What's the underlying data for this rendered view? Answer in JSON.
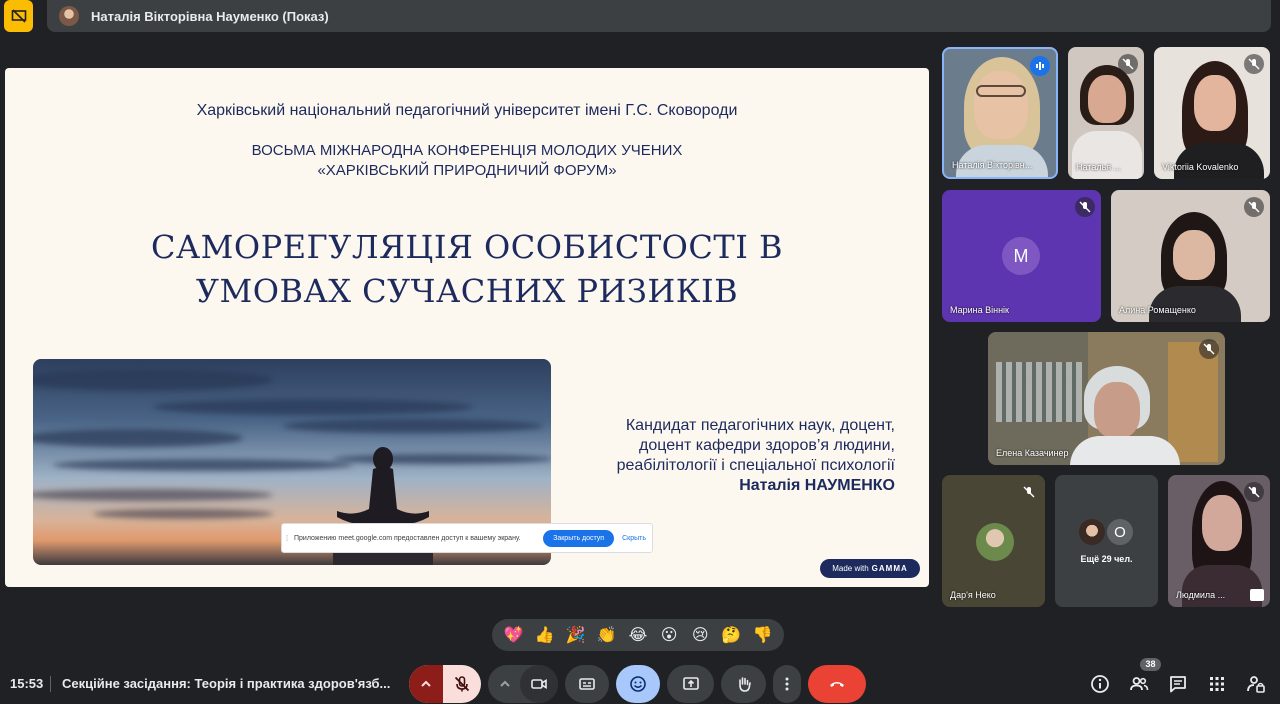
{
  "presenter_banner": {
    "text": "Наталія Вікторівна Науменко (Показ)"
  },
  "slide": {
    "university": "Харківський національний педагогічний університет імені Г.С. Сковороди",
    "conference_line1": "ВОСЬМА МІЖНАРОДНА КОНФЕРЕНЦІЯ МОЛОДИХ УЧЕНИХ",
    "conference_line2": "«ХАРКІВСЬКИЙ ПРИРОДНИЧИЙ ФОРУМ»",
    "title_line1": "САМОРЕГУЛЯЦІЯ ОСОБИСТОСТІ В",
    "title_line2": "УМОВАХ СУЧАСНИХ РИЗИКІВ",
    "author_line1": "Кандидат педагогічних наук, доцент,",
    "author_line2": "доцент кафедри здоров’я людини,",
    "author_line3": "реабілітології і спеціальної психології",
    "author_name": "Наталія НАУМЕНКО",
    "made_with": "Made with",
    "made_with_brand": "GAMMA"
  },
  "share_notification": {
    "text": "Приложению meet.google.com предоставлен доступ к вашему экрану.",
    "stop_label": "Закрыть доступ",
    "hide_label": "Скрыть"
  },
  "participants": [
    {
      "name": "Наталія Вікторівн...",
      "status": "speaking"
    },
    {
      "name": "Наталья ...",
      "status": "muted"
    },
    {
      "name": "Viktoriia Kovalenko",
      "status": "muted"
    },
    {
      "name": "Марина Віннік",
      "status": "muted",
      "initial": "M"
    },
    {
      "name": "Алина Ромащенко",
      "status": "muted"
    },
    {
      "name": "Елена Казачинер",
      "status": "muted"
    },
    {
      "name": "Дар'я Неко",
      "status": "muted"
    },
    {
      "name": "Ещё 29 чел.",
      "initial": "O"
    },
    {
      "name": "Людмила ...",
      "status": "muted"
    }
  ],
  "reactions": [
    "💖",
    "👍",
    "🎉",
    "👏",
    "😂",
    "😮",
    "😢",
    "🤔",
    "👎"
  ],
  "bottom_bar": {
    "time": "15:53",
    "meeting_title": "Секційне засідання: Теорія і практика здоров'язб...",
    "people_count": "38"
  },
  "colors": {
    "slide_text": "#1c2a5e",
    "leave_red": "#ea4335",
    "accent_blue": "#1a73e8",
    "present_yellow": "#fbbc04"
  }
}
